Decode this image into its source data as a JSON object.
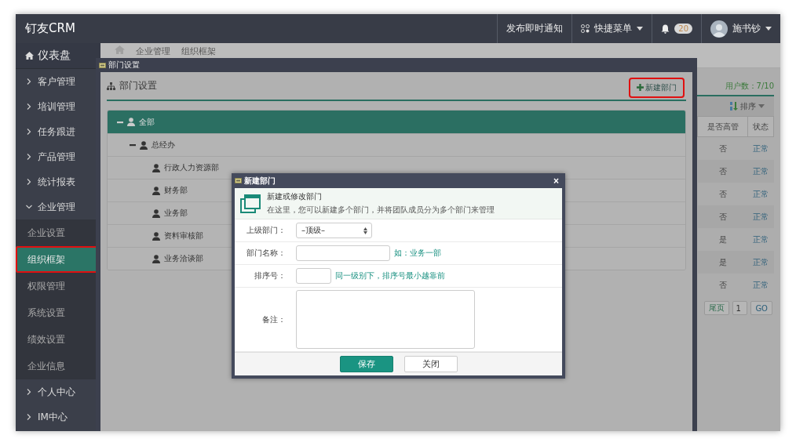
{
  "app": {
    "brand": "钉友CRM"
  },
  "topbar": {
    "items": [
      {
        "kind": "text",
        "label": "发布即时通知"
      },
      {
        "kind": "menu",
        "label": "快捷菜单"
      },
      {
        "kind": "bell",
        "badge": "20"
      },
      {
        "kind": "user",
        "label": "施书钞"
      }
    ]
  },
  "sidebar": {
    "dashboard": "仪表盘",
    "items": [
      {
        "label": "客户管理",
        "expanded": false
      },
      {
        "label": "培训管理",
        "expanded": false
      },
      {
        "label": "任务跟进",
        "expanded": false
      },
      {
        "label": "产品管理",
        "expanded": false
      },
      {
        "label": "统计报表",
        "expanded": false
      },
      {
        "label": "企业管理",
        "expanded": true,
        "children": [
          {
            "label": "企业设置",
            "selected": false,
            "highlighted": false
          },
          {
            "label": "组织框架",
            "selected": true,
            "highlighted": true
          },
          {
            "label": "权限管理",
            "selected": false,
            "highlighted": false
          },
          {
            "label": "系统设置",
            "selected": false,
            "highlighted": false
          },
          {
            "label": "绩效设置",
            "selected": false,
            "highlighted": false
          },
          {
            "label": "企业信息",
            "selected": false,
            "highlighted": false
          }
        ]
      },
      {
        "label": "个人中心",
        "expanded": false
      },
      {
        "label": "IM中心",
        "expanded": false
      }
    ]
  },
  "breadcrumb": [
    "企业管理",
    "组织框架"
  ],
  "user_panel": {
    "user_count": "用户数：7/10",
    "sort_button": "排序",
    "columns": [
      "是否高管",
      "状态"
    ],
    "rows": [
      {
        "cells": [
          "否",
          "正常"
        ]
      },
      {
        "cells": [
          "否",
          "正常"
        ]
      },
      {
        "cells": [
          "否",
          "正常"
        ]
      },
      {
        "cells": [
          "否",
          "正常"
        ]
      },
      {
        "cells": [
          "是",
          "正常"
        ]
      },
      {
        "cells": [
          "是",
          "正常"
        ]
      },
      {
        "cells": [
          "否",
          "正常"
        ]
      }
    ],
    "pagination": {
      "last": "尾页",
      "page": "1",
      "go": "GO"
    }
  },
  "dept_window": {
    "title": "部门设置",
    "header": "部门设置",
    "new_button": {
      "label": "新建部门",
      "highlighted": true
    },
    "tree": [
      {
        "label": "全部",
        "expanded": true,
        "selected": true,
        "children": [
          {
            "label": "总经办",
            "expanded": true,
            "selected": false,
            "children": [
              {
                "label": "行政人力资源部",
                "selected": false
              },
              {
                "label": "财务部",
                "selected": false
              },
              {
                "label": "业务部",
                "selected": false
              },
              {
                "label": "资料审核部",
                "selected": false
              },
              {
                "label": "业务洽谈部",
                "selected": false
              }
            ]
          }
        ]
      }
    ]
  },
  "dialog": {
    "title": "新建部门",
    "close": "×",
    "info": {
      "title": "新建或修改部门",
      "text": "在这里，您可以新建多个部门，并将团队成员分为多个部门来管理"
    },
    "fields": [
      {
        "kind": "select",
        "label": "上级部门：",
        "value": "–顶级–"
      },
      {
        "kind": "text",
        "label": "部门名称：",
        "hint": "如：业务一部"
      },
      {
        "kind": "short",
        "label": "排序号：",
        "hint": "同一级别下，排序号最小越靠前"
      },
      {
        "kind": "textarea",
        "label": "备注："
      }
    ],
    "buttons": [
      {
        "label": "保存",
        "kind": "primary"
      },
      {
        "label": "关闭",
        "kind": "default"
      }
    ]
  }
}
